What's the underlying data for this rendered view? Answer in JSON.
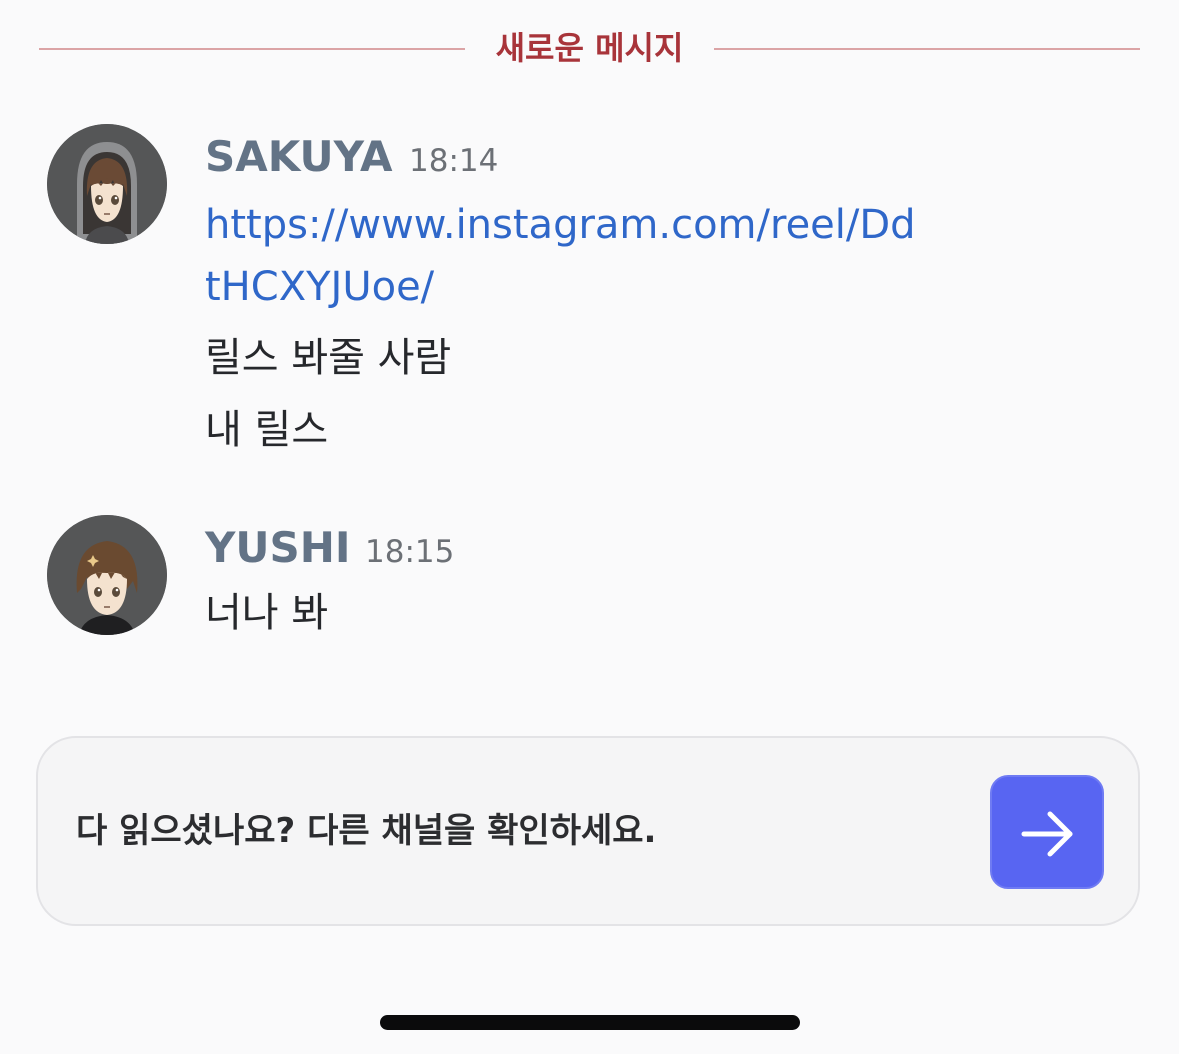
{
  "divider": {
    "label": "새로운 메시지",
    "color": "#a8343a"
  },
  "messages": [
    {
      "author": "SAKUYA",
      "time": "18:14",
      "link": "https://www.instagram.com/reel/DdtHCXYJUoe/",
      "lines": [
        "릴스 봐줄 사람",
        "내 릴스"
      ],
      "avatar": "hooded-boy-avatar"
    },
    {
      "author": "YUSHI",
      "time": "18:15",
      "lines": [
        "너나 봐"
      ],
      "avatar": "boy-avatar"
    }
  ],
  "prompt": {
    "text": "다 읽으셨나요? 다른 채널을 확인하세요.",
    "button_icon": "arrow-right-icon",
    "button_color": "#5865f2"
  },
  "colors": {
    "author": "#637386",
    "link": "#2f67c9",
    "background": "#fafafb"
  }
}
